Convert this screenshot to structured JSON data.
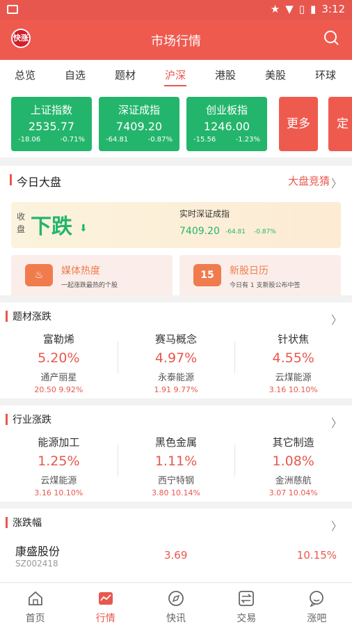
{
  "status": {
    "time": "3:12"
  },
  "app": {
    "title": "市场行情",
    "logo_text": "快涨"
  },
  "tabs": [
    "总览",
    "自选",
    "题材",
    "沪深",
    "港股",
    "美股",
    "环球"
  ],
  "active_tab": "沪深",
  "indices": [
    {
      "name": "上证指数",
      "value": "2535.77",
      "change": "-18.06",
      "pct": "-0.71%"
    },
    {
      "name": "深证成指",
      "value": "7409.20",
      "change": "-64.81",
      "pct": "-0.87%"
    },
    {
      "name": "创业板指",
      "value": "1246.00",
      "change": "-15.56",
      "pct": "-1.23%"
    }
  ],
  "more_label": "更多",
  "next_card_fragment": "定",
  "today": {
    "title": "今日大盘",
    "link": "大盘竞猜",
    "side_label": "收盘",
    "status": "下跌",
    "realtime_label": "实时深证成指",
    "realtime_value": "7409.20",
    "realtime_change": "-64.81",
    "realtime_pct": "-0.87%",
    "features": [
      {
        "title": "媒体热度",
        "sub": "一起涨跌最热的个股",
        "icon_text": ""
      },
      {
        "title": "新股日历",
        "sub": "今日有 1 支新股公布中签",
        "icon_text": "15"
      }
    ]
  },
  "topics": {
    "title": "题材涨跌",
    "items": [
      {
        "name": "富勒烯",
        "pct": "5.20%",
        "stock": "通产丽星",
        "price": "20.50",
        "stock_pct": "9.92%"
      },
      {
        "name": "赛马概念",
        "pct": "4.97%",
        "stock": "永泰能源",
        "price": "1.91",
        "stock_pct": "9.77%"
      },
      {
        "name": "针状焦",
        "pct": "4.55%",
        "stock": "云煤能源",
        "price": "3.16",
        "stock_pct": "10.10%"
      }
    ]
  },
  "industries": {
    "title": "行业涨跌",
    "items": [
      {
        "name": "能源加工",
        "pct": "1.25%",
        "stock": "云煤能源",
        "price": "3.16",
        "stock_pct": "10.10%"
      },
      {
        "name": "黑色金属",
        "pct": "1.11%",
        "stock": "西宁特钢",
        "price": "3.80",
        "stock_pct": "10.14%"
      },
      {
        "name": "其它制造",
        "pct": "1.08%",
        "stock": "金洲慈航",
        "price": "3.07",
        "stock_pct": "10.04%"
      }
    ]
  },
  "movers": {
    "title": "涨跌幅",
    "rows": [
      {
        "name": "康盛股份",
        "code": "SZ002418",
        "price": "3.69",
        "pct": "10.15%"
      }
    ]
  },
  "nav": [
    {
      "label": "首页",
      "icon": "home-icon"
    },
    {
      "label": "行情",
      "icon": "chart-icon"
    },
    {
      "label": "快讯",
      "icon": "compass-icon"
    },
    {
      "label": "交易",
      "icon": "trade-icon"
    },
    {
      "label": "涨吧",
      "icon": "chat-icon"
    }
  ],
  "colors": {
    "brand": "#ef5a4f",
    "up": "#e8574e",
    "down": "#24b56c"
  }
}
